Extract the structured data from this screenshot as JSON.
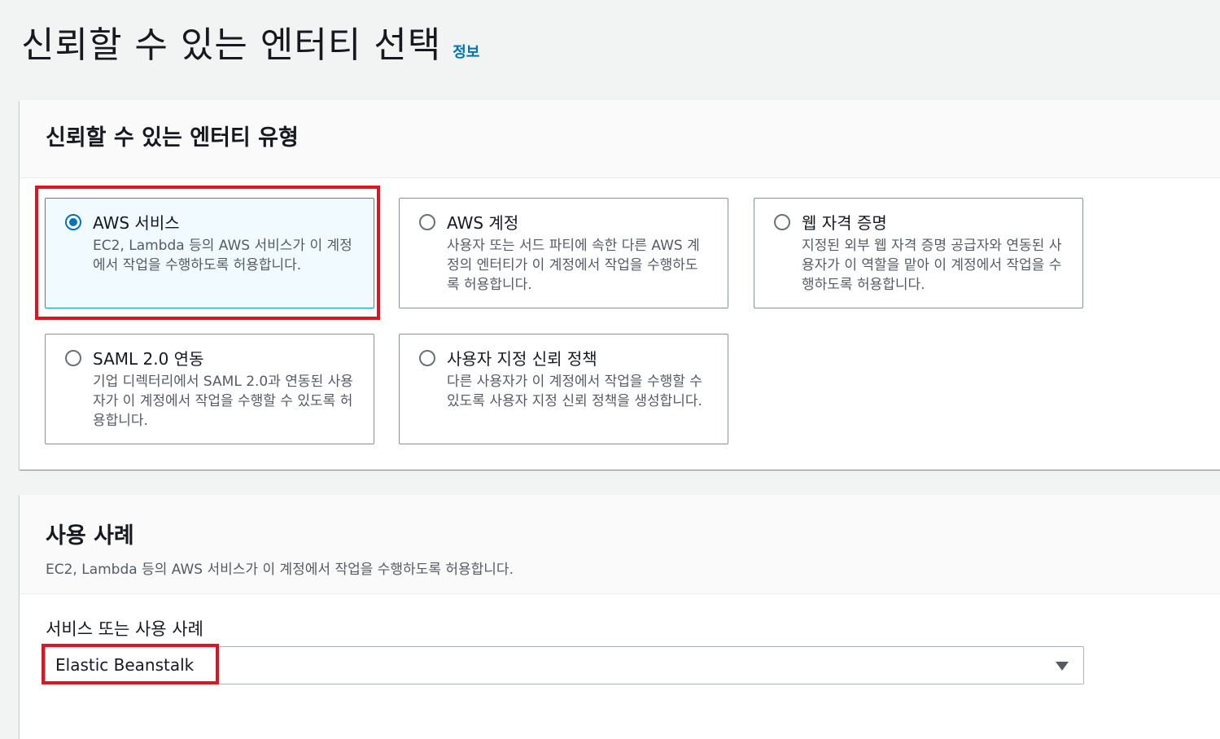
{
  "page": {
    "title": "신뢰할 수 있는 엔터티 선택",
    "info_link": "정보"
  },
  "entity_panel": {
    "title": "신뢰할 수 있는 엔터티 유형",
    "options": [
      {
        "title": "AWS 서비스",
        "description": "EC2, Lambda 등의 AWS 서비스가 이 계정에서 작업을 수행하도록 허용합니다.",
        "selected": true
      },
      {
        "title": "AWS 계정",
        "description": "사용자 또는 서드 파티에 속한 다른 AWS 계정의 엔터티가 이 계정에서 작업을 수행하도록 허용합니다.",
        "selected": false
      },
      {
        "title": "웹 자격 증명",
        "description": "지정된 외부 웹 자격 증명 공급자와 연동된 사용자가 이 역할을 맡아 이 계정에서 작업을 수행하도록 허용합니다.",
        "selected": false
      },
      {
        "title": "SAML 2.0 연동",
        "description": "기업 디렉터리에서 SAML 2.0과 연동된 사용자가 이 계정에서 작업을 수행할 수 있도록 허용합니다.",
        "selected": false
      },
      {
        "title": "사용자 지정 신뢰 정책",
        "description": "다른 사용자가 이 계정에서 작업을 수행할 수 있도록 사용자 지정 신뢰 정책을 생성합니다.",
        "selected": false
      }
    ]
  },
  "usecase_panel": {
    "title": "사용 사례",
    "description": "EC2, Lambda 등의 AWS 서비스가 이 계정에서 작업을 수행하도록 허용합니다.",
    "field_label": "서비스 또는 사용 사례",
    "selected_value": "Elastic Beanstalk",
    "caret_icon": "caret-down-icon"
  },
  "colors": {
    "accent": "#0073bb",
    "highlight": "#e0131f",
    "selected_tile_bg": "#f1faff"
  }
}
